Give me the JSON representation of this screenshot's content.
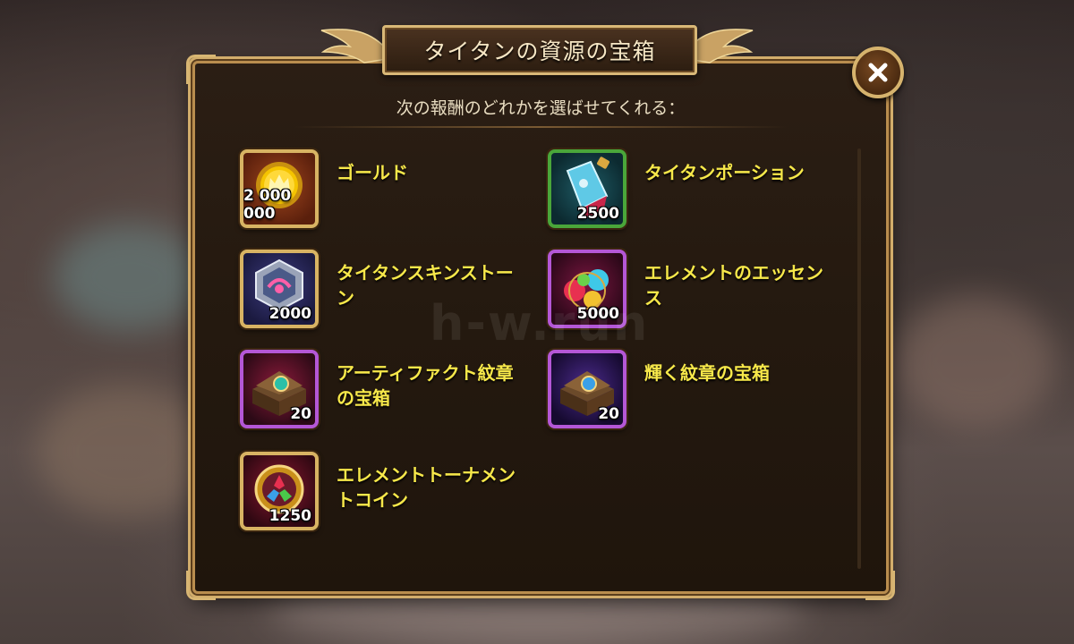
{
  "dialog": {
    "title": "タイタンの資源の宝箱",
    "subtitle": "次の報酬のどれかを選ばせてくれる："
  },
  "watermark": "h-w.run",
  "rewards": [
    {
      "name": "ゴールド",
      "quantity": "2 000 000",
      "frame": "gold",
      "icon": "gold-coin-icon"
    },
    {
      "name": "タイタンポーション",
      "quantity": "2500",
      "frame": "green",
      "icon": "titan-potion-icon"
    },
    {
      "name": "タイタンスキンストーン",
      "quantity": "2000",
      "frame": "gold",
      "icon": "titan-skin-stone-icon"
    },
    {
      "name": "エレメントのエッセンス",
      "quantity": "5000",
      "frame": "purple",
      "icon": "element-essence-icon"
    },
    {
      "name": "アーティファクト紋章の宝箱",
      "quantity": "20",
      "frame": "purple",
      "icon": "artifact-emblem-chest-icon"
    },
    {
      "name": "輝く紋章の宝箱",
      "quantity": "20",
      "frame": "purple",
      "icon": "shining-emblem-chest-icon"
    },
    {
      "name": "エレメントトーナメントコイン",
      "quantity": "1250",
      "frame": "gold",
      "icon": "element-tournament-coin-icon"
    }
  ],
  "colors": {
    "frame_gold": "#d8b363",
    "frame_green": "#4aa63a",
    "frame_purple": "#b457d6",
    "reward_text": "#f7e84a"
  }
}
